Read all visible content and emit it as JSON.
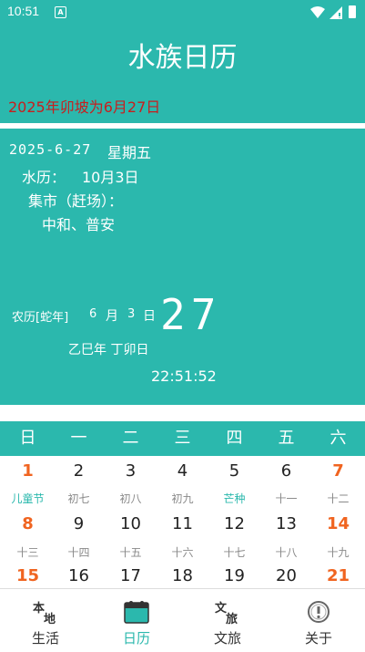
{
  "status_bar": {
    "time": "10:51",
    "badge": "A"
  },
  "app_title": "水族日历",
  "hs_line": "2025年卯坡为6月27日",
  "today": {
    "gregorian": "2025-6-27",
    "weekday": "星期五",
    "shuili_label": "水历：",
    "shuili_value": "10月3日",
    "market_label": "集市（赶场）：",
    "market_value": "中和、普安",
    "lunar_label": "农历[蛇年]",
    "lunar_month": "6",
    "lunar_yue": "月",
    "lunar_day": "3",
    "lunar_ri": "日",
    "big_day": "27",
    "ganzhi": "乙巳年 丁卯日",
    "clock": "22:51:52"
  },
  "week_headers": [
    "日",
    "一",
    "二",
    "三",
    "四",
    "五",
    "六"
  ],
  "calendar_rows": [
    {
      "days": [
        "1",
        "2",
        "3",
        "4",
        "5",
        "6",
        "7"
      ],
      "notes": [
        "儿童节",
        "初七",
        "初八",
        "初九",
        "芒种",
        "十一",
        "十二"
      ]
    },
    {
      "days": [
        "8",
        "9",
        "10",
        "11",
        "12",
        "13",
        "14"
      ],
      "notes": [
        "十三",
        "十四",
        "十五",
        "十六",
        "十七",
        "十八",
        "十九"
      ]
    },
    {
      "days": [
        "15",
        "16",
        "17",
        "18",
        "19",
        "20",
        "21"
      ],
      "notes": []
    }
  ],
  "colors": {
    "teal": "#2bb8ad",
    "weekend": "#f06420",
    "hs_red": "#c81e1e"
  },
  "nav": [
    {
      "label": "生活",
      "icon": "local-life-icon",
      "active": false
    },
    {
      "label": "日历",
      "icon": "calendar-icon",
      "active": true
    },
    {
      "label": "文旅",
      "icon": "culture-travel-icon",
      "active": false
    },
    {
      "label": "关于",
      "icon": "about-info-icon",
      "active": false
    }
  ]
}
